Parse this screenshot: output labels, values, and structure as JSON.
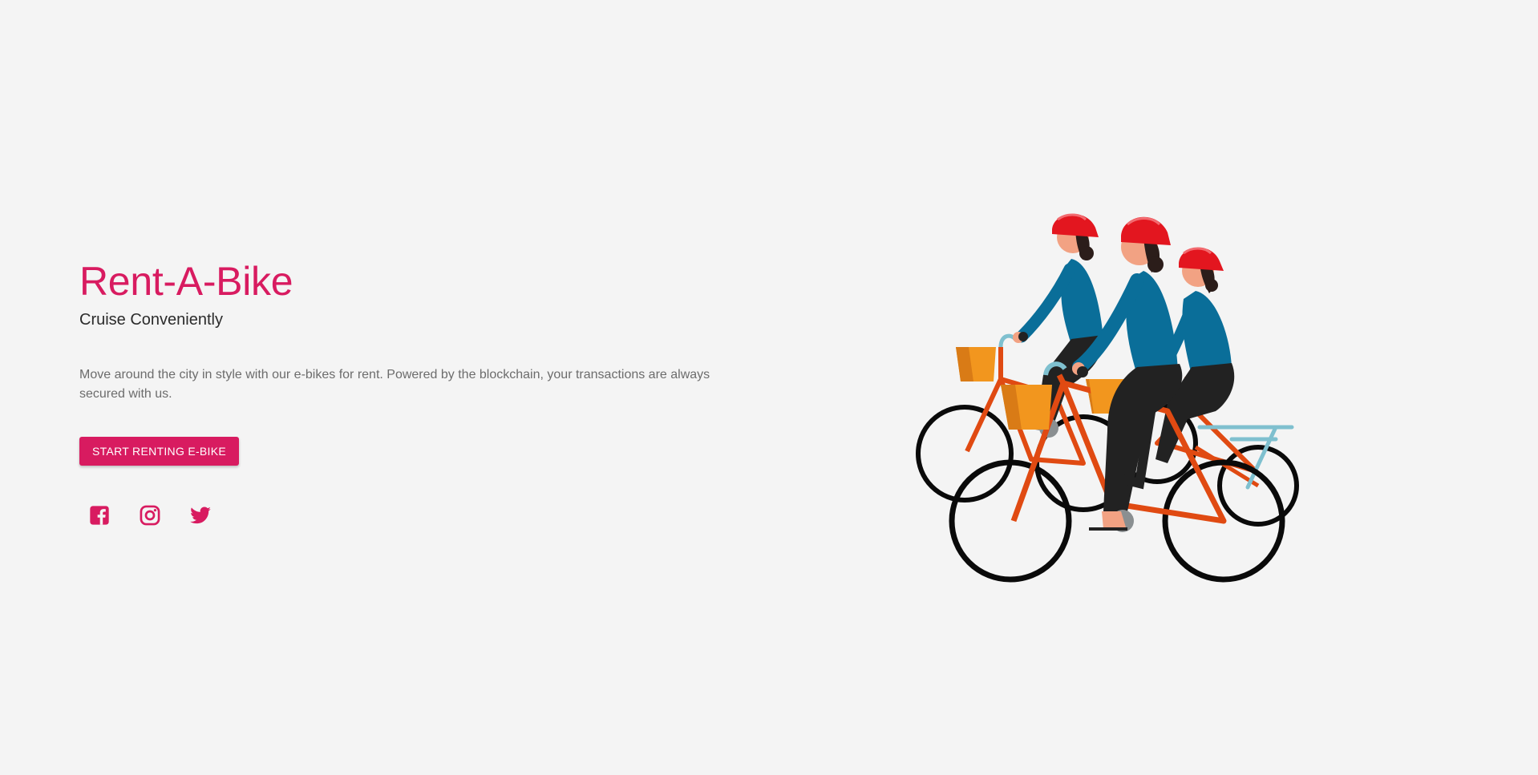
{
  "hero": {
    "title": "Rent-A-Bike",
    "subtitle": "Cruise Conveniently",
    "description": "Move around the city in style with our e-bikes for rent. Powered by the blockchain, your transactions are always secured with us.",
    "cta_label": "START RENTING E-BIKE"
  },
  "socials": [
    {
      "icon": "facebook-icon"
    },
    {
      "icon": "instagram-icon"
    },
    {
      "icon": "twitter-icon"
    }
  ],
  "colors": {
    "brand": "#d81b60",
    "background": "#f4f4f4",
    "subtitle": "#2b2b2b",
    "body_text": "#6c6c6c",
    "helmet": "#e3161f",
    "shirt": "#0a6e99",
    "pants": "#222222",
    "bike_frame": "#e04a12",
    "bike_rack": "#7fc0cf",
    "basket": "#f2961e",
    "wheel": "#0a0a0a"
  }
}
